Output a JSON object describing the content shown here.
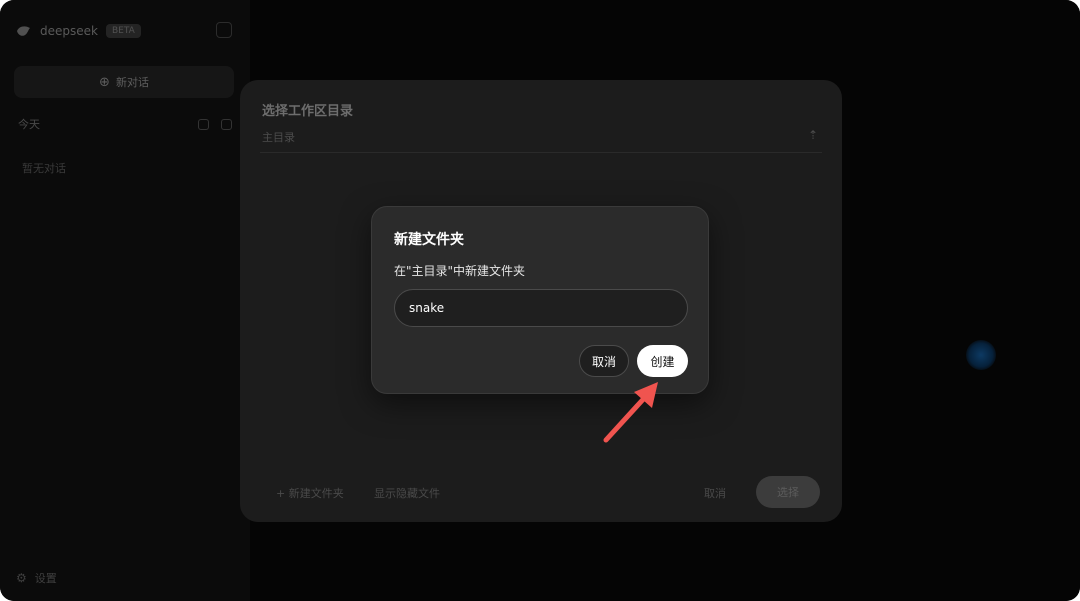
{
  "sidebar": {
    "brand_name": "deepseek",
    "brand_badge": "BETA",
    "new_chat_label": "新对话",
    "section_label": "今天",
    "empty_hint": "暂无对话",
    "settings_label": "设置"
  },
  "directory_dialog": {
    "title": "选择工作区目录",
    "path": "主目录",
    "new_folder_label": "+ 新建文件夹",
    "show_hidden_label": "显示隐藏文件",
    "cancel_label": "取消",
    "confirm_label": "选择"
  },
  "new_folder_dialog": {
    "title": "新建文件夹",
    "description": "在\"主目录\"中新建文件夹",
    "input_value": "snake",
    "cancel_label": "取消",
    "create_label": "创建"
  },
  "colors": {
    "annotation_arrow": "#f0544f",
    "dialog_bg": "#2b2b2b",
    "primary_button": "#ffffff"
  }
}
